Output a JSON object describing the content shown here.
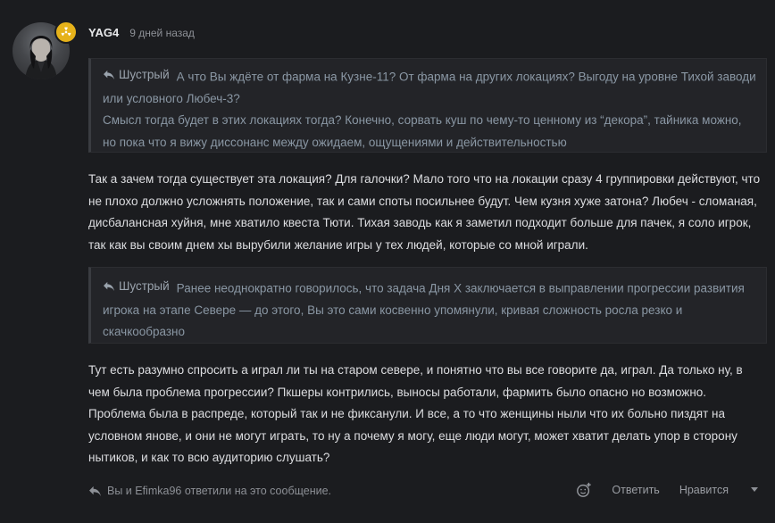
{
  "post": {
    "author": "YAG4",
    "time_ago": "9 дней назад",
    "badge_icon": "radiation-icon",
    "badge_color": "#e6b21a"
  },
  "quotes": [
    {
      "author": "Шустрый",
      "lines": [
        "А что Вы ждёте от фарма на Кузне-11? От фарма на других локациях? Выгоду на уровне Тихой заводи или условного Любеч-3?",
        "Смысл тогда будет в этих локациях тогда? Конечно, сорвать куш по чему-то ценному из “декора”, тайника можно, но пока что я вижу диссонанс между ожидаем, ощущениями и действительностью"
      ]
    },
    {
      "author": "Шустрый",
      "lines": [
        "Ранее неоднократно говорилось, что задача Дня X заключается в выправлении прогрессии развития игрока на этапе Севере — до этого, Вы это сами косвенно упомянули, кривая сложность росла резко и скачкообразно"
      ]
    }
  ],
  "messages": [
    "Так а зачем тогда существует эта локация? Для галочки? Мало того что на локации сразу 4 группировки действуют, что не плохо должно усложнять положение, так и сами споты посильнее будут. Чем кузня хуже затона? Любеч - сломаная, дисбалансная хуйня, мне хватило квеста Тюти. Тихая заводь как я заметил подходит больше для пачек, я соло игрок, так как вы своим днем хы вырубили желание игры у тех людей, которые со мной играли.",
    "Тут есть разумно спросить а играл ли ты на старом севере, и понятно что вы все говорите да, играл. Да только ну, в чем была проблема прогрессии? Пкшеры контрились, выносы работали, фармить было опасно но возможно. Проблема была в распреде, который так и не фиксанули. И все, а то что женщины ныли что их больно пиздят на условном янове, и они не могут играть, то ну а почему я могу, еще люди могут, может хватит делать упор в сторону нытиков, и как то всю аудиторию слушать?"
  ],
  "footer": {
    "replies_text": "Вы и Efimka96 ответили на это сообщение.",
    "reply_label": "Ответить",
    "like_label": "Нравится"
  }
}
